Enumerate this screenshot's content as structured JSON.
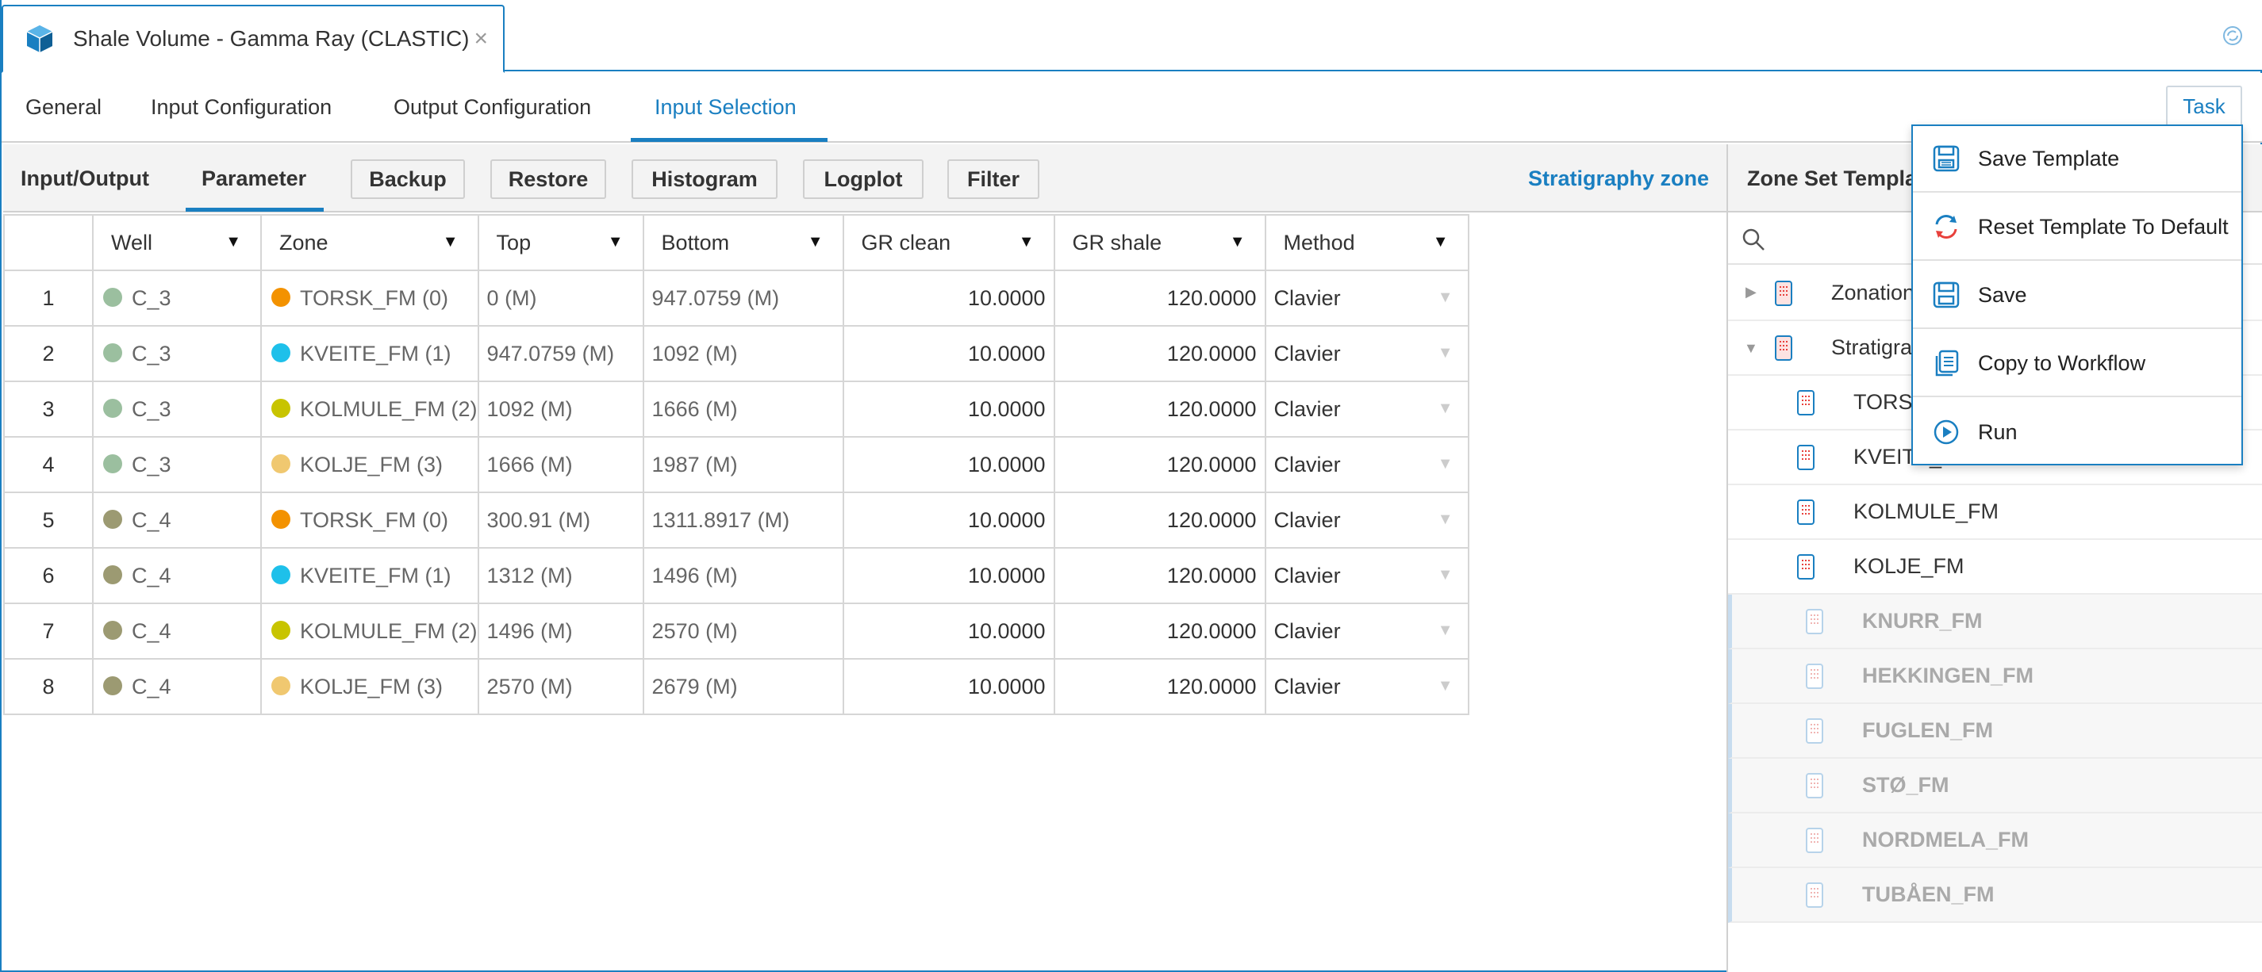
{
  "window": {
    "title": "Shale Volume - Gamma Ray (CLASTIC)",
    "close_glyph": "×",
    "icon": "cube-icon",
    "right_icon": "sync-icon"
  },
  "nav": {
    "tabs": [
      {
        "label": "General"
      },
      {
        "label": "Input Configuration"
      },
      {
        "label": "Output Configuration"
      },
      {
        "label": "Input Selection"
      }
    ],
    "active": "Input Selection",
    "task_button": "Task"
  },
  "toolbar": {
    "tabs": [
      {
        "label": "Input/Output"
      },
      {
        "label": "Parameter"
      }
    ],
    "active": "Parameter",
    "buttons": [
      {
        "label": "Backup"
      },
      {
        "label": "Restore"
      },
      {
        "label": "Histogram"
      },
      {
        "label": "Logplot"
      },
      {
        "label": "Filter"
      }
    ],
    "stratigraphy_link": "Stratigraphy zone"
  },
  "grid": {
    "columns": [
      "Well",
      "Zone",
      "Top",
      "Bottom",
      "GR clean",
      "GR shale",
      "Method"
    ],
    "sort_glyph": "▼",
    "dropdown_glyph": "▼",
    "rows": [
      {
        "num": "1",
        "well": "C_3",
        "well_color": "#9bbf9f",
        "zone": "TORSK_FM (0)",
        "zone_color": "#f39200",
        "top": "0 (M)",
        "bottom": "947.0759 (M)",
        "gr_clean": "10.0000",
        "gr_shale": "120.0000",
        "method": "Clavier"
      },
      {
        "num": "2",
        "well": "C_3",
        "well_color": "#9bbf9f",
        "zone": "KVEITE_FM (1)",
        "zone_color": "#1ec0ea",
        "top": "947.0759 (M)",
        "bottom": "1092 (M)",
        "gr_clean": "10.0000",
        "gr_shale": "120.0000",
        "method": "Clavier"
      },
      {
        "num": "3",
        "well": "C_3",
        "well_color": "#9bbf9f",
        "zone": "KOLMULE_FM (2)",
        "zone_color": "#c8c400",
        "top": "1092 (M)",
        "bottom": "1666 (M)",
        "gr_clean": "10.0000",
        "gr_shale": "120.0000",
        "method": "Clavier"
      },
      {
        "num": "4",
        "well": "C_3",
        "well_color": "#9bbf9f",
        "zone": "KOLJE_FM (3)",
        "zone_color": "#f0c870",
        "top": "1666 (M)",
        "bottom": "1987 (M)",
        "gr_clean": "10.0000",
        "gr_shale": "120.0000",
        "method": "Clavier"
      },
      {
        "num": "5",
        "well": "C_4",
        "well_color": "#9c9a72",
        "zone": "TORSK_FM (0)",
        "zone_color": "#f39200",
        "top": "300.91 (M)",
        "bottom": "1311.8917 (M)",
        "gr_clean": "10.0000",
        "gr_shale": "120.0000",
        "method": "Clavier"
      },
      {
        "num": "6",
        "well": "C_4",
        "well_color": "#9c9a72",
        "zone": "KVEITE_FM (1)",
        "zone_color": "#1ec0ea",
        "top": "1312 (M)",
        "bottom": "1496 (M)",
        "gr_clean": "10.0000",
        "gr_shale": "120.0000",
        "method": "Clavier"
      },
      {
        "num": "7",
        "well": "C_4",
        "well_color": "#9c9a72",
        "zone": "KOLMULE_FM (2)",
        "zone_color": "#c8c400",
        "top": "1496 (M)",
        "bottom": "2570 (M)",
        "gr_clean": "10.0000",
        "gr_shale": "120.0000",
        "method": "Clavier"
      },
      {
        "num": "8",
        "well": "C_4",
        "well_color": "#9c9a72",
        "zone": "KOLJE_FM (3)",
        "zone_color": "#f0c870",
        "top": "2570 (M)",
        "bottom": "2679 (M)",
        "gr_clean": "10.0000",
        "gr_shale": "120.0000",
        "method": "Clavier"
      }
    ]
  },
  "right_pane": {
    "title": "Zone Set Templa",
    "search_icon": "search-icon",
    "tree": [
      {
        "label": "Zonation",
        "caret": "right",
        "level": 0,
        "enabled": true
      },
      {
        "label": "Stratigra",
        "caret": "down",
        "level": 0,
        "enabled": true
      },
      {
        "label": "TORSK",
        "level": 1,
        "enabled": true
      },
      {
        "label": "KVEITE_FM",
        "level": 1,
        "enabled": true
      },
      {
        "label": "KOLMULE_FM",
        "level": 1,
        "enabled": true
      },
      {
        "label": "KOLJE_FM",
        "level": 1,
        "enabled": true
      },
      {
        "label": "KNURR_FM",
        "level": 1,
        "enabled": false
      },
      {
        "label": "HEKKINGEN_FM",
        "level": 1,
        "enabled": false
      },
      {
        "label": "FUGLEN_FM",
        "level": 1,
        "enabled": false
      },
      {
        "label": "STØ_FM",
        "level": 1,
        "enabled": false
      },
      {
        "label": "NORDMELA_FM",
        "level": 1,
        "enabled": false
      },
      {
        "label": "TUBÅEN_FM",
        "level": 1,
        "enabled": false
      }
    ]
  },
  "context_menu": {
    "items": [
      {
        "label": "Save Template",
        "icon": "save-template-icon"
      },
      {
        "label": "Reset Template To Default",
        "icon": "reset-icon"
      },
      {
        "label": "Save",
        "icon": "save-icon"
      },
      {
        "label": "Copy to Workflow",
        "icon": "copy-icon"
      },
      {
        "label": "Run",
        "icon": "run-icon"
      }
    ]
  },
  "colors": {
    "accent": "#1a7fc1",
    "border": "#d6d6d6",
    "toolbar_bg": "#f3f3f3"
  }
}
